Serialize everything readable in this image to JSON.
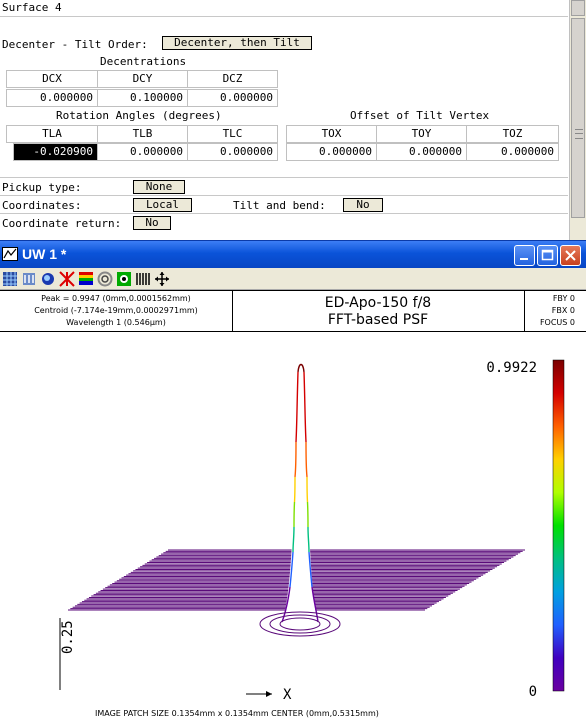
{
  "surface_dialog": {
    "title": "Surface 4",
    "decenter_order_label": "Decenter - Tilt Order:",
    "decenter_order_value": "Decenter, then Tilt",
    "decentrations_heading": "Decentrations",
    "decentrations": {
      "headers": [
        "DCX",
        "DCY",
        "DCZ"
      ],
      "values": [
        "0.000000",
        "0.100000",
        "0.000000"
      ]
    },
    "rotation_heading": "Rotation Angles (degrees)",
    "offset_heading": "Offset of Tilt Vertex",
    "rotation": {
      "headers": [
        "TLA",
        "TLB",
        "TLC"
      ],
      "values": [
        "-0.020900",
        "0.000000",
        "0.000000"
      ]
    },
    "offset": {
      "headers": [
        "TOX",
        "TOY",
        "TOZ"
      ],
      "values": [
        "0.000000",
        "0.000000",
        "0.000000"
      ]
    },
    "pickup_label": "Pickup type:",
    "pickup_value": "None",
    "coordinates_label": "Coordinates:",
    "coordinates_value": "Local",
    "tilt_bend_label": "Tilt and bend:",
    "tilt_bend_value": "No",
    "coord_return_label": "Coordinate return:",
    "coord_return_value": "No"
  },
  "uw_window": {
    "title": "UW 1 *",
    "toolbar_icons": [
      "grid-icon",
      "settings-icon",
      "color-icon",
      "scatter-icon",
      "rainbow-icon",
      "ring-icon",
      "target-icon",
      "bars-icon",
      "move-icon"
    ],
    "header": {
      "peak": "Peak = 0.9947 (0mm,0.0001562mm)",
      "centroid": "Centroid (-7.174e-19mm,0.0002971mm)",
      "wavelength": "Wavelength 1 (0.546µm)",
      "title_line1": "ED-Apo-150 f/8",
      "title_line2": "FFT-based PSF",
      "fby": "FBY 0",
      "fbx": "FBX 0",
      "focus": "FOCUS 0"
    },
    "plot": {
      "colorbar_max": "0.9922",
      "colorbar_min": "0",
      "z_tick": "0.25",
      "axis_label": "X",
      "footer": "IMAGE PATCH SIZE 0.1354mm x 0.1354mm      CENTER (0mm,0.5315mm)",
      "colors": [
        "#7a0000",
        "#d40000",
        "#ff6000",
        "#ffd000",
        "#b0ff00",
        "#00e000",
        "#00c080",
        "#00a0e0",
        "#2060ff",
        "#4000c0",
        "#6a00a0"
      ],
      "line_color": "#5a0a7a"
    }
  }
}
